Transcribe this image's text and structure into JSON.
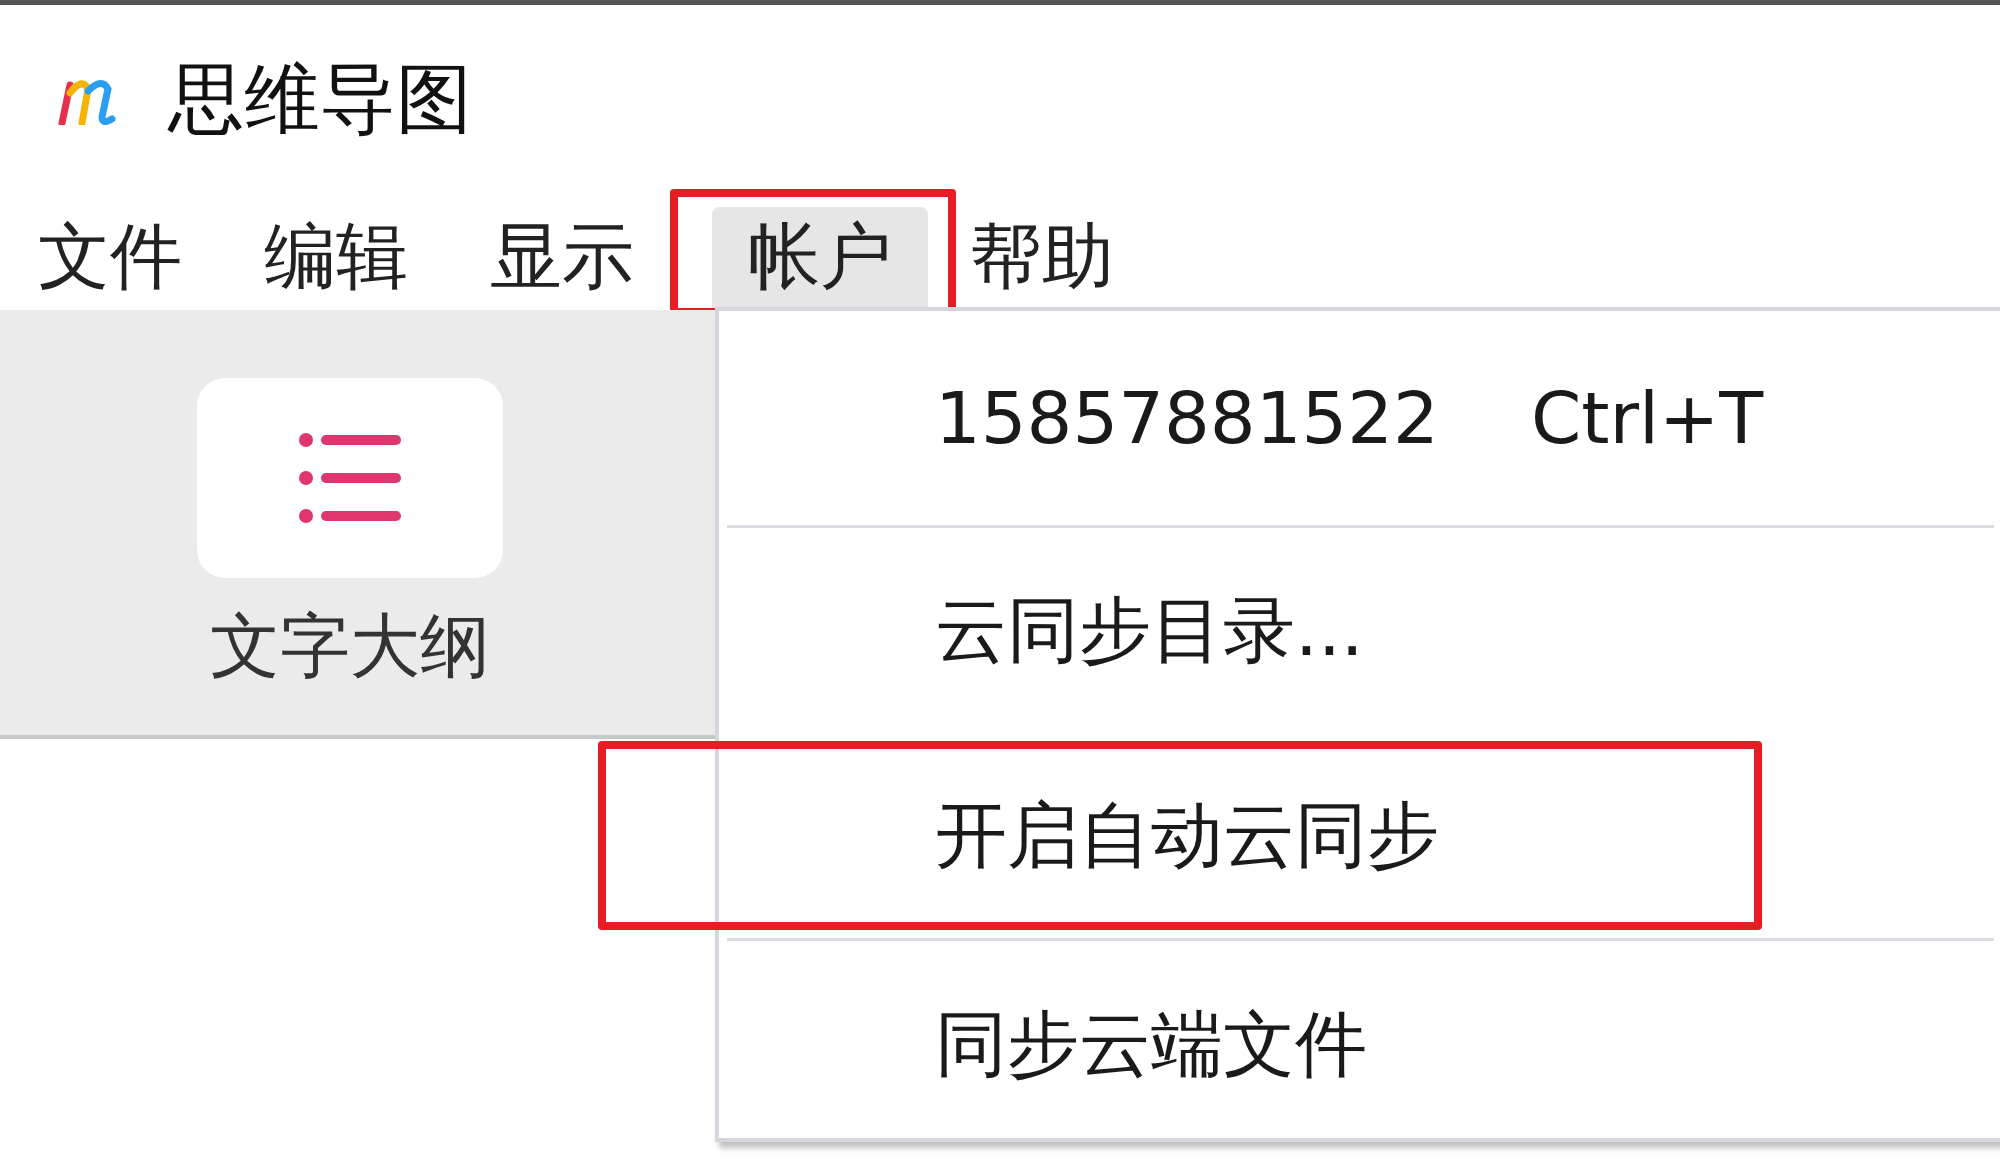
{
  "app": {
    "title": "思维导图"
  },
  "menu_bar": [
    {
      "label": "文件",
      "selected": false,
      "annotated": false
    },
    {
      "label": "编辑",
      "selected": false,
      "annotated": false
    },
    {
      "label": "显示",
      "selected": false,
      "annotated": false
    },
    {
      "label": "帐户",
      "selected": true,
      "annotated": true
    },
    {
      "label": "帮助",
      "selected": false,
      "annotated": false
    }
  ],
  "panel": {
    "tiles": [
      {
        "label": "文字大纲"
      }
    ]
  },
  "dropdown": [
    {
      "kind": "item",
      "label": "15857881522",
      "shortcut": "Ctrl+T",
      "annotated": false
    },
    {
      "kind": "separator"
    },
    {
      "kind": "item",
      "label": "云同步目录...",
      "annotated": false
    },
    {
      "kind": "item",
      "label": "开启自动云同步",
      "annotated": true
    },
    {
      "kind": "separator"
    },
    {
      "kind": "item",
      "label": "同步云端文件",
      "annotated": false
    }
  ]
}
